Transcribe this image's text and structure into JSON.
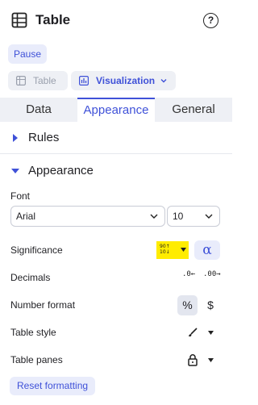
{
  "header": {
    "title": "Table",
    "help_glyph": "?"
  },
  "pause_label": "Pause",
  "view": {
    "table_label": "Table",
    "visualization_label": "Visualization"
  },
  "tabs": [
    {
      "label": "Data"
    },
    {
      "label": "Appearance",
      "active": true
    },
    {
      "label": "General"
    }
  ],
  "sections": {
    "rules": "Rules",
    "appearance": "Appearance"
  },
  "font": {
    "label": "Font",
    "family_value": "Arial",
    "size_value": "10"
  },
  "rows": {
    "significance": "Significance",
    "decimals": "Decimals",
    "number_format": "Number format",
    "table_style": "Table style",
    "table_panes": "Table panes"
  },
  "significance_icon_top": "90↑",
  "significance_icon_bottom": "10↓",
  "alpha_glyph": "α",
  "decimals_less": ".0←",
  "decimals_more": ".00→",
  "number_format": {
    "percent": "%",
    "dollar": "$"
  },
  "reset_label": "Reset formatting",
  "colors": {
    "accent": "#3f51d8",
    "significance_highlight": "#ffec00",
    "tab_bar": "#eef0f5"
  }
}
